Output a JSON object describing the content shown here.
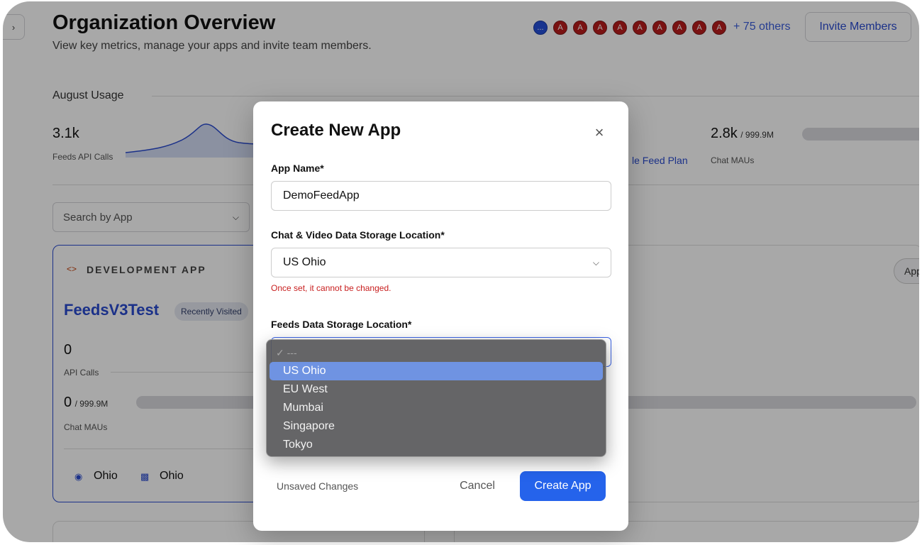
{
  "page": {
    "title": "Organization Overview",
    "subtitle": "View key metrics, manage your apps and invite team members.",
    "collapse_glyph": "›"
  },
  "header": {
    "avatar_initials": [
      "...",
      "A",
      "A",
      "A",
      "A",
      "A",
      "A",
      "A",
      "A",
      "A"
    ],
    "others_text": "+ 75 others",
    "invite_label": "Invite Members"
  },
  "usage": {
    "title": "August Usage",
    "metrics": [
      {
        "value": "3.1k",
        "label": "Feeds API Calls"
      },
      {
        "value": "2.8k",
        "limit": "/ 999.9M",
        "label": "Chat MAUs"
      }
    ],
    "plan_link": "le Feed Plan"
  },
  "search": {
    "placeholder": "Search by App"
  },
  "app_card": {
    "type_label": "DEVELOPMENT APP",
    "name": "FeedsV3Test",
    "badge": "Recently Visited",
    "api_value": "0",
    "api_label": "API Calls",
    "mau_value": "0",
    "mau_limit": "/ 999.9M",
    "mau_label": "Chat MAUs",
    "feeds_location": "Ohio",
    "chat_location": "Ohio",
    "side_button": "App"
  },
  "modal": {
    "title": "Create New App",
    "close_glyph": "×",
    "app_name_label": "App Name*",
    "app_name_value": "DemoFeedApp",
    "chat_location_label": "Chat & Video Data Storage Location*",
    "chat_location_value": "US Ohio",
    "location_warning": "Once set, it cannot be changed.",
    "feeds_location_label": "Feeds Data Storage Location*",
    "unsaved_text": "Unsaved Changes",
    "cancel_label": "Cancel",
    "create_label": "Create App"
  },
  "dropdown": {
    "placeholder": "✓ ---",
    "options": [
      "US Ohio",
      "EU West",
      "Mumbai",
      "Singapore",
      "Tokyo"
    ],
    "highlighted": "US Ohio"
  },
  "colors": {
    "accent": "#2563eb",
    "link": "#2a4bd0",
    "error": "#c81e1e",
    "avatar_red": "#b91c1c",
    "highlight": "#6f93e2"
  }
}
